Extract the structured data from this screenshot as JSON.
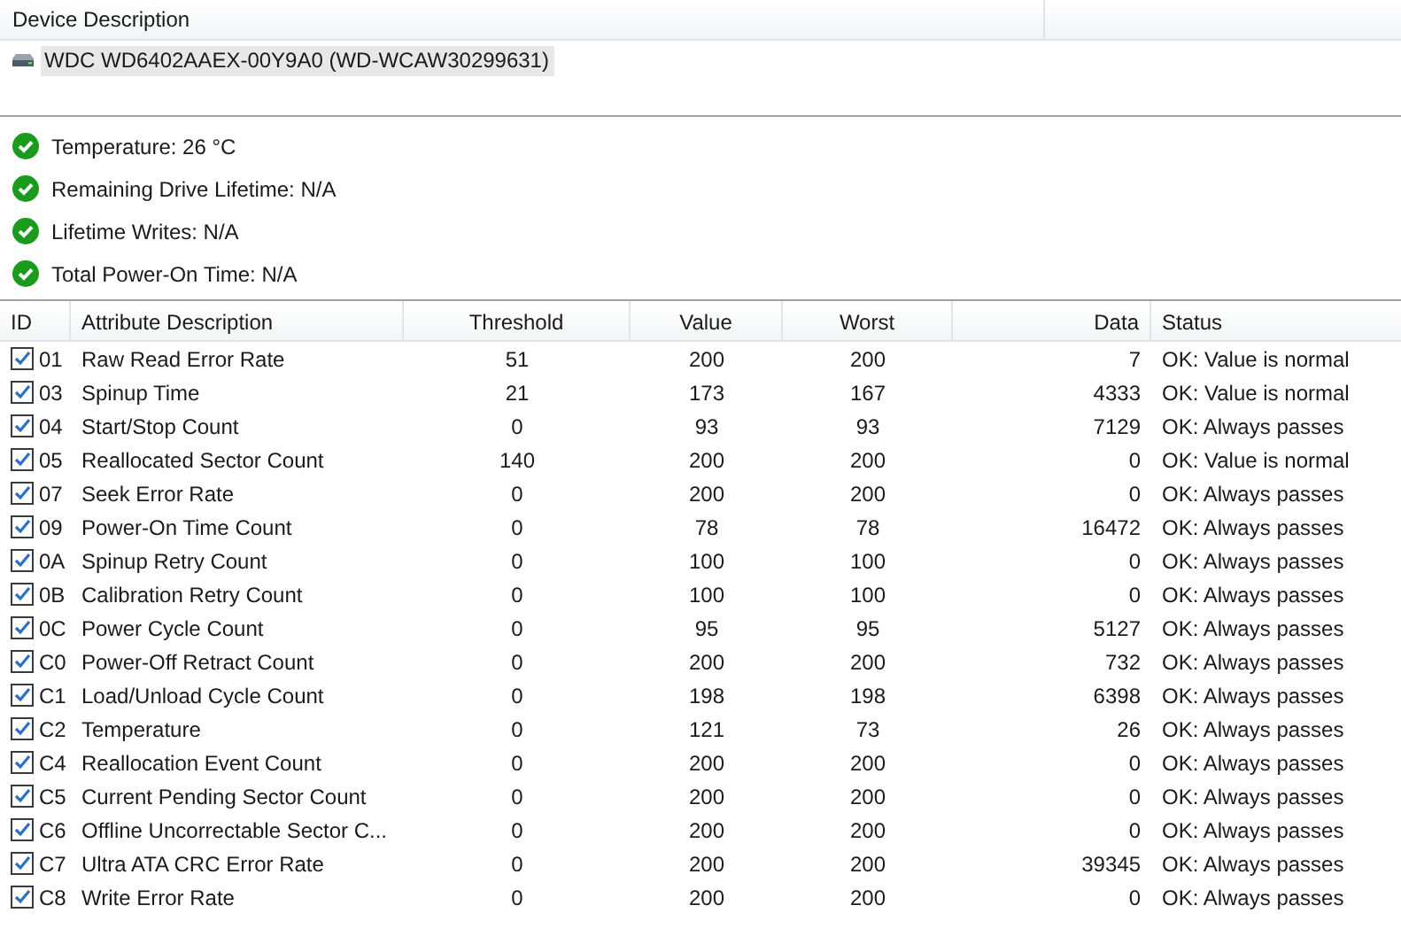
{
  "device_list": {
    "header": "Device Description",
    "devices": [
      {
        "name": "WDC WD6402AAEX-00Y9A0 (WD-WCAW30299631)",
        "selected": true
      }
    ]
  },
  "summary": [
    {
      "text": "Temperature: 26 °C",
      "color": "#1b9a1b"
    },
    {
      "text": "Remaining Drive Lifetime: N/A",
      "color": "#1b9a1b"
    },
    {
      "text": "Lifetime Writes: N/A",
      "color": "#1b9a1b"
    },
    {
      "text": "Total Power-On Time: N/A",
      "color": "#1b9a1b"
    }
  ],
  "table": {
    "columns": [
      "ID",
      "Attribute Description",
      "Threshold",
      "Value",
      "Worst",
      "Data",
      "Status"
    ],
    "rows": [
      {
        "checked": true,
        "cells": [
          "01",
          "Raw Read Error Rate",
          "51",
          "200",
          "200",
          "7",
          "OK: Value is normal"
        ]
      },
      {
        "checked": true,
        "cells": [
          "03",
          "Spinup Time",
          "21",
          "173",
          "167",
          "4333",
          "OK: Value is normal"
        ]
      },
      {
        "checked": true,
        "cells": [
          "04",
          "Start/Stop Count",
          "0",
          "93",
          "93",
          "7129",
          "OK: Always passes"
        ]
      },
      {
        "checked": true,
        "cells": [
          "05",
          "Reallocated Sector Count",
          "140",
          "200",
          "200",
          "0",
          "OK: Value is normal"
        ]
      },
      {
        "checked": true,
        "cells": [
          "07",
          "Seek Error Rate",
          "0",
          "200",
          "200",
          "0",
          "OK: Always passes"
        ]
      },
      {
        "checked": true,
        "cells": [
          "09",
          "Power-On Time Count",
          "0",
          "78",
          "78",
          "16472",
          "OK: Always passes"
        ]
      },
      {
        "checked": true,
        "cells": [
          "0A",
          "Spinup Retry Count",
          "0",
          "100",
          "100",
          "0",
          "OK: Always passes"
        ]
      },
      {
        "checked": true,
        "cells": [
          "0B",
          "Calibration Retry Count",
          "0",
          "100",
          "100",
          "0",
          "OK: Always passes"
        ]
      },
      {
        "checked": true,
        "cells": [
          "0C",
          "Power Cycle Count",
          "0",
          "95",
          "95",
          "5127",
          "OK: Always passes"
        ]
      },
      {
        "checked": true,
        "cells": [
          "C0",
          "Power-Off Retract Count",
          "0",
          "200",
          "200",
          "732",
          "OK: Always passes"
        ]
      },
      {
        "checked": true,
        "cells": [
          "C1",
          "Load/Unload Cycle Count",
          "0",
          "198",
          "198",
          "6398",
          "OK: Always passes"
        ]
      },
      {
        "checked": true,
        "cells": [
          "C2",
          "Temperature",
          "0",
          "121",
          "73",
          "26",
          "OK: Always passes"
        ]
      },
      {
        "checked": true,
        "cells": [
          "C4",
          "Reallocation Event Count",
          "0",
          "200",
          "200",
          "0",
          "OK: Always passes"
        ]
      },
      {
        "checked": true,
        "cells": [
          "C5",
          "Current Pending Sector Count",
          "0",
          "200",
          "200",
          "0",
          "OK: Always passes"
        ]
      },
      {
        "checked": true,
        "cells": [
          "C6",
          "Offline Uncorrectable Sector C...",
          "0",
          "200",
          "200",
          "0",
          "OK: Always passes"
        ]
      },
      {
        "checked": true,
        "cells": [
          "C7",
          "Ultra ATA CRC Error Rate",
          "0",
          "200",
          "200",
          "39345",
          "OK: Always passes"
        ]
      },
      {
        "checked": true,
        "cells": [
          "C8",
          "Write Error Rate",
          "0",
          "200",
          "200",
          "0",
          "OK: Always passes"
        ]
      }
    ]
  }
}
